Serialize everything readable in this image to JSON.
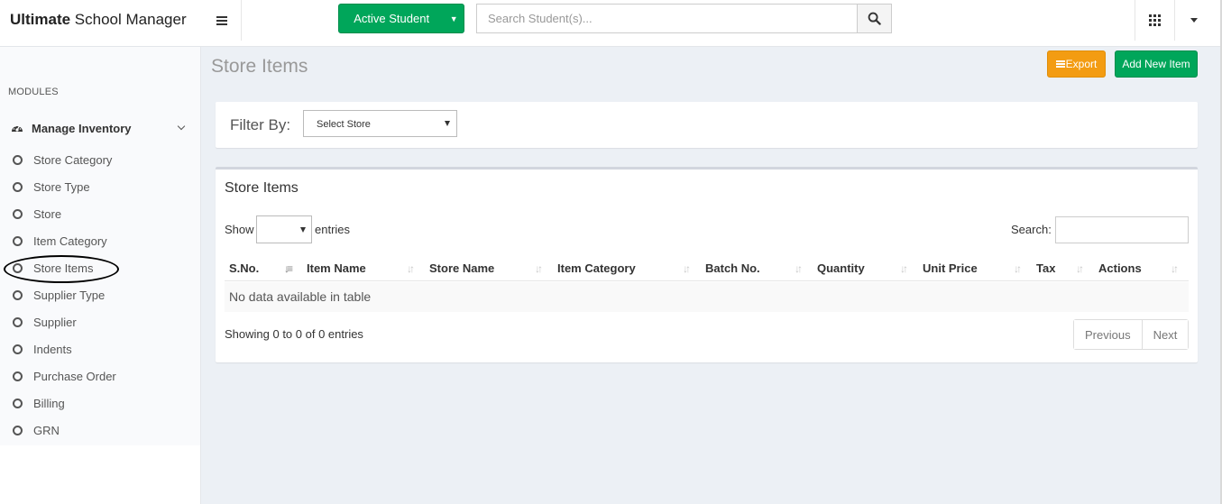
{
  "header": {
    "brand_bold": "Ultimate",
    "brand_rest": " School Manager",
    "active_student_label": "Active Student",
    "search_placeholder": "Search Student(s)..."
  },
  "sidebar": {
    "section_label": "MODULES",
    "group_label": "Manage Inventory",
    "items": [
      {
        "label": "Store Category"
      },
      {
        "label": "Store Type"
      },
      {
        "label": "Store"
      },
      {
        "label": "Item Category"
      },
      {
        "label": "Store Items"
      },
      {
        "label": "Supplier Type"
      },
      {
        "label": "Supplier"
      },
      {
        "label": "Indents"
      },
      {
        "label": "Purchase Order"
      },
      {
        "label": "Billing"
      },
      {
        "label": "GRN"
      }
    ]
  },
  "page": {
    "title": "Store Items",
    "export_label": "Export",
    "add_label": "Add New Item"
  },
  "filter": {
    "label": "Filter By:",
    "store_select_value": "Select Store"
  },
  "table": {
    "box_title": "Store Items",
    "show_label": "Show",
    "entries_label": "entries",
    "search_label": "Search:",
    "columns": [
      "S.No.",
      "Item Name",
      "Store Name",
      "Item Category",
      "Batch No.",
      "Quantity",
      "Unit Price",
      "Tax",
      "Actions"
    ],
    "empty_message": "No data available in table",
    "info": "Showing 0 to 0 of 0 entries",
    "prev_label": "Previous",
    "next_label": "Next"
  },
  "colors": {
    "success_green": "#00a65a",
    "warning_orange": "#f39c12",
    "content_bg": "#ecf0f5"
  }
}
